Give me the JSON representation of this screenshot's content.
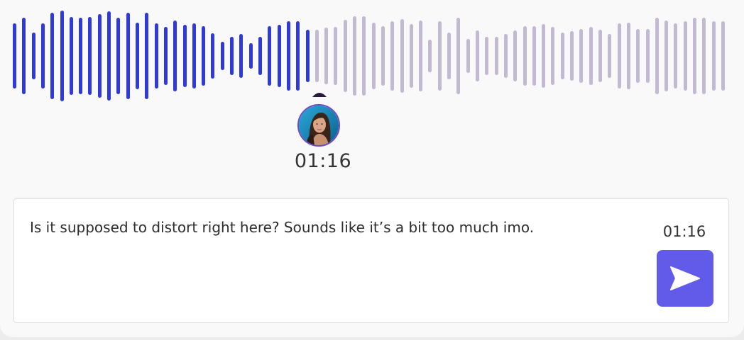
{
  "player": {
    "progress": 0.425,
    "current_time": "01:16",
    "played_color": "#2f3ad8",
    "unplayed_color": "#c2b9d3",
    "bar_amplitudes": [
      0.72,
      0.84,
      0.52,
      0.72,
      0.96,
      1.0,
      0.86,
      0.84,
      0.86,
      0.92,
      0.98,
      0.84,
      0.96,
      0.74,
      0.96,
      0.72,
      0.64,
      0.78,
      0.68,
      0.72,
      0.66,
      0.5,
      0.32,
      0.42,
      0.48,
      0.28,
      0.42,
      0.66,
      0.68,
      0.76,
      0.76,
      0.58,
      0.58,
      0.62,
      0.64,
      0.8,
      0.88,
      0.88,
      0.74,
      0.66,
      0.76,
      0.82,
      0.7,
      0.78,
      0.36,
      0.76,
      0.52,
      0.84,
      0.38,
      0.56,
      0.42,
      0.42,
      0.48,
      0.56,
      0.66,
      0.66,
      0.7,
      0.64,
      0.52,
      0.54,
      0.6,
      0.64,
      0.58,
      0.48,
      0.72,
      0.74,
      0.6,
      0.6,
      0.84,
      0.78,
      0.72,
      0.76,
      0.84,
      0.84,
      0.76,
      0.76
    ],
    "playhead_icon": "caret-up-icon",
    "avatar_icon": "user-avatar"
  },
  "comment": {
    "text": "Is it supposed to distort right here? Sounds like it’s a bit too much imo.",
    "timestamp": "01:16",
    "send_icon": "send-arrow-icon",
    "send_color": "#625bea"
  }
}
